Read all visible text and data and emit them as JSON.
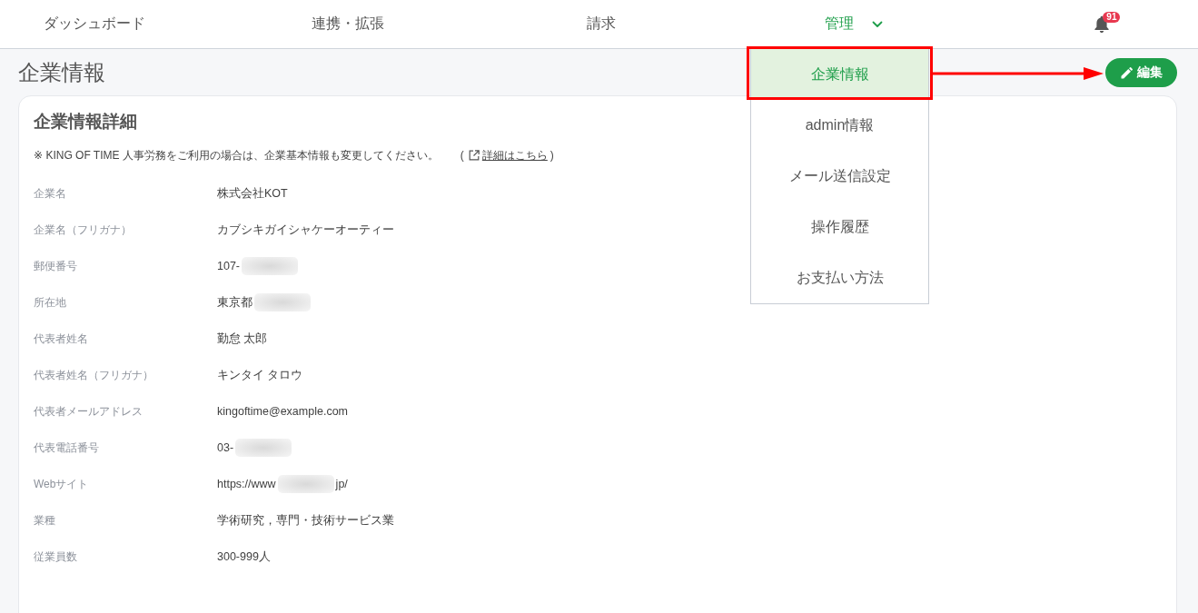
{
  "nav": {
    "items": [
      {
        "label": "ダッシュボード",
        "selected": false,
        "dropdown": false
      },
      {
        "label": "連携・拡張",
        "selected": false,
        "dropdown": false
      },
      {
        "label": "請求",
        "selected": false,
        "dropdown": false
      },
      {
        "label": "管理",
        "selected": true,
        "dropdown": true
      }
    ],
    "notifications": {
      "badge": "91"
    }
  },
  "dropdown_menu": {
    "items": [
      {
        "label": "企業情報",
        "selected": true,
        "highlighted": true
      },
      {
        "label": "admin情報",
        "selected": false,
        "highlighted": false
      },
      {
        "label": "メール送信設定",
        "selected": false,
        "highlighted": false
      },
      {
        "label": "操作履歴",
        "selected": false,
        "highlighted": false
      },
      {
        "label": "お支払い方法",
        "selected": false,
        "highlighted": false
      }
    ]
  },
  "callout_arrow": true,
  "page": {
    "title": "企業情報",
    "edit_button": "編集"
  },
  "card": {
    "title": "企業情報詳細",
    "note": "※ KING OF TIME 人事労務をご利用の場合は、企業基本情報も変更してください。",
    "link_open": "(",
    "link": "詳細はこちら",
    "link_close": ")",
    "fields": [
      {
        "label": "企業名",
        "value": "株式会社KOT",
        "redacted": false
      },
      {
        "label": "企業名（フリガナ）",
        "value": "カブシキガイシャケーオーティー",
        "redacted": false
      },
      {
        "label": "郵便番号",
        "value": "107-",
        "redacted": true
      },
      {
        "label": "所在地",
        "value": "東京都",
        "redacted": true
      },
      {
        "label": "代表者姓名",
        "value": "勤怠 太郎",
        "redacted": false
      },
      {
        "label": "代表者姓名（フリガナ）",
        "value": "キンタイ タロウ",
        "redacted": false
      },
      {
        "label": "代表者メールアドレス",
        "value": "kingoftime@example.com",
        "redacted": false
      },
      {
        "label": "代表電話番号",
        "value": "03-",
        "redacted": true
      },
      {
        "label": "Webサイト",
        "value": "https://www",
        "redacted": true,
        "value_after": "jp/"
      },
      {
        "label": "業種",
        "value": "学術研究，専門・技術サービス業",
        "redacted": false
      },
      {
        "label": "従業員数",
        "value": "300-999人",
        "redacted": false
      }
    ]
  }
}
